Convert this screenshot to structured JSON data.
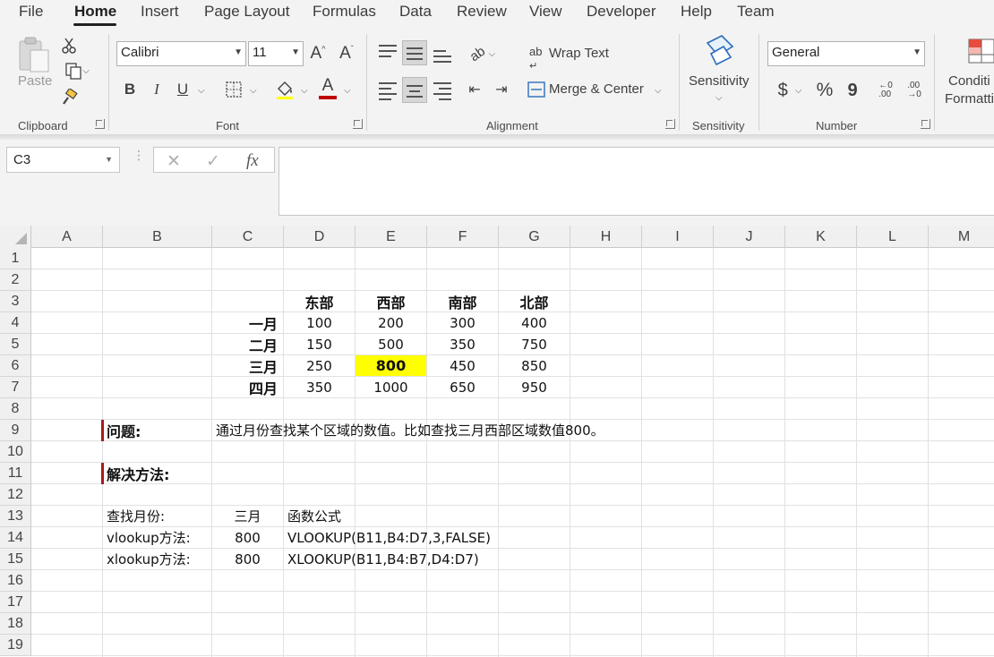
{
  "menu": [
    "File",
    "Home",
    "Insert",
    "Page Layout",
    "Formulas",
    "Data",
    "Review",
    "View",
    "Developer",
    "Help",
    "Team"
  ],
  "active_menu": "Home",
  "ribbon": {
    "clipboard": {
      "paste_label": "Paste",
      "group_label": "Clipboard"
    },
    "font": {
      "font_name": "Calibri",
      "font_size": "11",
      "bold": "B",
      "italic": "I",
      "underline": "U",
      "font_color_glyph": "A",
      "group_label": "Font"
    },
    "alignment": {
      "wrap_text": "Wrap Text",
      "merge_center": "Merge & Center",
      "group_label": "Alignment"
    },
    "sensitivity": {
      "button_label": "Sensitivity",
      "group_label": "Sensitivity"
    },
    "number": {
      "format": "General",
      "currency": "$",
      "percent": "%",
      "comma": "9",
      "group_label": "Number"
    },
    "styles": {
      "conditional_line1": "Conditi",
      "conditional_line2": "Formatti"
    }
  },
  "formula_bar": {
    "name_box": "C3",
    "fx_label": "fx",
    "value": ""
  },
  "columns": [
    "A",
    "B",
    "C",
    "D",
    "E",
    "F",
    "G",
    "H",
    "I",
    "J",
    "K",
    "L",
    "M"
  ],
  "rows": [
    "1",
    "2",
    "3",
    "4",
    "5",
    "6",
    "7",
    "8",
    "9",
    "10",
    "11",
    "12",
    "13",
    "14",
    "15",
    "16",
    "17",
    "18",
    "19"
  ],
  "table": {
    "headers": [
      "东部",
      "西部",
      "南部",
      "北部"
    ],
    "row_labels": [
      "一月",
      "二月",
      "三月",
      "四月"
    ],
    "values": [
      [
        "100",
        "200",
        "300",
        "400"
      ],
      [
        "150",
        "500",
        "350",
        "750"
      ],
      [
        "250",
        "800",
        "450",
        "850"
      ],
      [
        "350",
        "1000",
        "650",
        "950"
      ]
    ],
    "highlight_color": "#ffff00"
  },
  "question": {
    "label": "问题:",
    "text": "通过月份查找某个区域的数值。比如查找三月西部区域数值800。"
  },
  "solution": {
    "label": "解决方法:"
  },
  "lookup": {
    "month_label": "查找月份:",
    "month_value": "三月",
    "formula_header": "函数公式",
    "vlookup_label": "vlookup方法:",
    "vlookup_result": "800",
    "vlookup_formula": "VLOOKUP(B11,B4:D7,3,FALSE)",
    "xlookup_label": "xlookup方法:",
    "xlookup_result": "800",
    "xlookup_formula": "XLOOKUP(B11,B4:B7,D4:D7)"
  },
  "accent_red": "#a61c1c"
}
